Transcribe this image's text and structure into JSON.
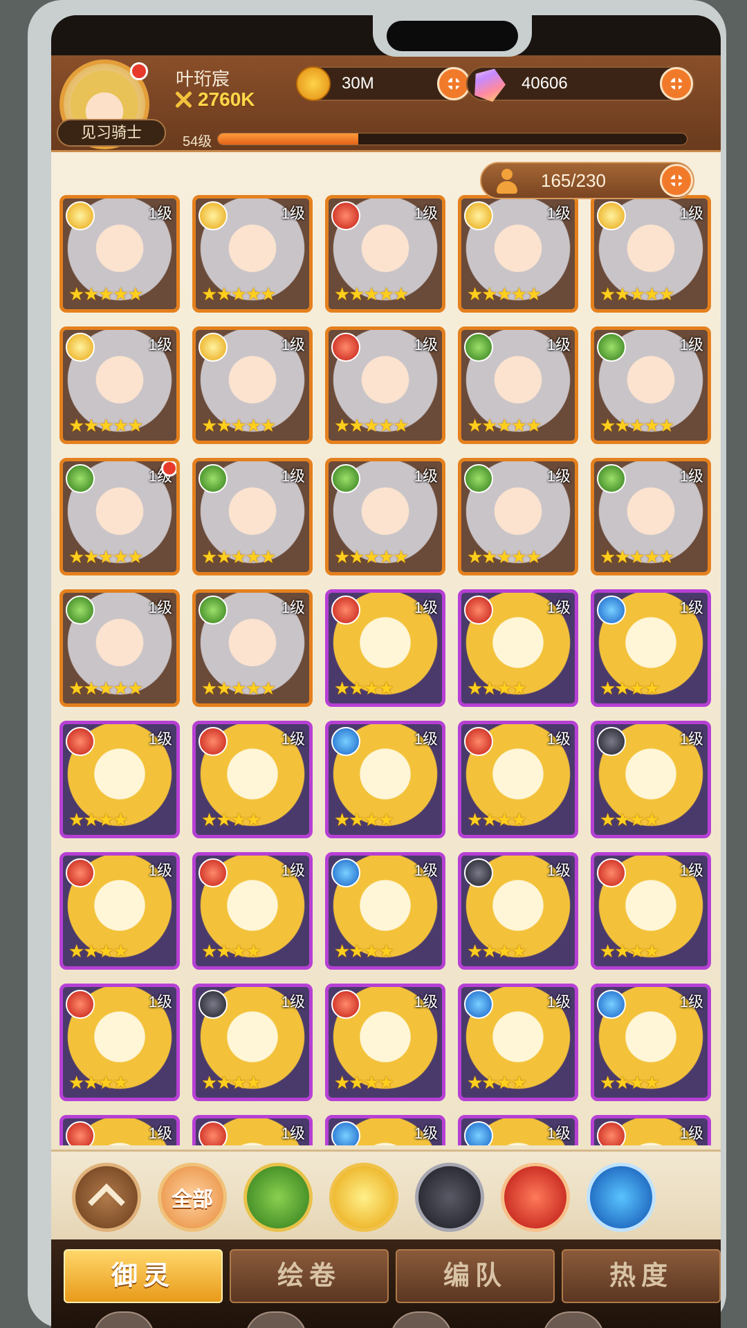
{
  "player": {
    "name": "叶珩宸",
    "power": "2760K",
    "level": "54级",
    "xp_fraction": 0.3,
    "title": "见习骑士"
  },
  "currency": {
    "gold": "30M",
    "gems": "40606"
  },
  "roster": {
    "count": "165/230"
  },
  "cards": [
    {
      "element": "gold",
      "level": "1级",
      "stars": "★★★★★",
      "frame": "orange",
      "notif": false
    },
    {
      "element": "gold",
      "level": "1级",
      "stars": "★★★★★",
      "frame": "orange",
      "notif": false
    },
    {
      "element": "red",
      "level": "1级",
      "stars": "★★★★★",
      "frame": "orange",
      "notif": false
    },
    {
      "element": "gold",
      "level": "1级",
      "stars": "★★★★★",
      "frame": "orange",
      "notif": false
    },
    {
      "element": "gold",
      "level": "1级",
      "stars": "★★★★★",
      "frame": "orange",
      "notif": false
    },
    {
      "element": "gold",
      "level": "1级",
      "stars": "★★★★★",
      "frame": "orange",
      "notif": false
    },
    {
      "element": "gold",
      "level": "1级",
      "stars": "★★★★★",
      "frame": "orange",
      "notif": false
    },
    {
      "element": "red",
      "level": "1级",
      "stars": "★★★★★",
      "frame": "orange",
      "notif": false
    },
    {
      "element": "green",
      "level": "1级",
      "stars": "★★★★★",
      "frame": "orange",
      "notif": false
    },
    {
      "element": "green",
      "level": "1级",
      "stars": "★★★★★",
      "frame": "orange",
      "notif": false
    },
    {
      "element": "green",
      "level": "1级",
      "stars": "★★★★★",
      "frame": "orange",
      "notif": true
    },
    {
      "element": "green",
      "level": "1级",
      "stars": "★★★★★",
      "frame": "orange",
      "notif": false
    },
    {
      "element": "green",
      "level": "1级",
      "stars": "★★★★★",
      "frame": "orange",
      "notif": false
    },
    {
      "element": "green",
      "level": "1级",
      "stars": "★★★★★",
      "frame": "orange",
      "notif": false
    },
    {
      "element": "green",
      "level": "1级",
      "stars": "★★★★★",
      "frame": "orange",
      "notif": false
    },
    {
      "element": "green",
      "level": "1级",
      "stars": "★★★★★",
      "frame": "orange",
      "notif": false
    },
    {
      "element": "green",
      "level": "1级",
      "stars": "★★★★★",
      "frame": "orange",
      "notif": false
    },
    {
      "element": "red",
      "level": "1级",
      "stars": "★★★★",
      "frame": "purple",
      "notif": false
    },
    {
      "element": "red",
      "level": "1级",
      "stars": "★★★★",
      "frame": "purple",
      "notif": false
    },
    {
      "element": "blue",
      "level": "1级",
      "stars": "★★★★",
      "frame": "purple",
      "notif": false
    },
    {
      "element": "red",
      "level": "1级",
      "stars": "★★★★",
      "frame": "purple",
      "notif": false
    },
    {
      "element": "red",
      "level": "1级",
      "stars": "★★★★",
      "frame": "purple",
      "notif": false
    },
    {
      "element": "blue",
      "level": "1级",
      "stars": "★★★★",
      "frame": "purple",
      "notif": false
    },
    {
      "element": "red",
      "level": "1级",
      "stars": "★★★★",
      "frame": "purple",
      "notif": false
    },
    {
      "element": "dark",
      "level": "1级",
      "stars": "★★★★",
      "frame": "purple",
      "notif": false
    },
    {
      "element": "red",
      "level": "1级",
      "stars": "★★★★",
      "frame": "purple",
      "notif": false
    },
    {
      "element": "red",
      "level": "1级",
      "stars": "★★★★",
      "frame": "purple",
      "notif": false
    },
    {
      "element": "blue",
      "level": "1级",
      "stars": "★★★★",
      "frame": "purple",
      "notif": false
    },
    {
      "element": "dark",
      "level": "1级",
      "stars": "★★★★",
      "frame": "purple",
      "notif": false
    },
    {
      "element": "red",
      "level": "1级",
      "stars": "★★★★",
      "frame": "purple",
      "notif": false
    },
    {
      "element": "red",
      "level": "1级",
      "stars": "★★★★",
      "frame": "purple",
      "notif": false
    },
    {
      "element": "dark",
      "level": "1级",
      "stars": "★★★★",
      "frame": "purple",
      "notif": false
    },
    {
      "element": "red",
      "level": "1级",
      "stars": "★★★★",
      "frame": "purple",
      "notif": false
    },
    {
      "element": "blue",
      "level": "1级",
      "stars": "★★★★",
      "frame": "purple",
      "notif": false
    },
    {
      "element": "blue",
      "level": "1级",
      "stars": "★★★★",
      "frame": "purple",
      "notif": false
    },
    {
      "element": "red",
      "level": "1级",
      "stars": "",
      "frame": "purple",
      "notif": false
    },
    {
      "element": "red",
      "level": "1级",
      "stars": "",
      "frame": "purple",
      "notif": false
    },
    {
      "element": "blue",
      "level": "1级",
      "stars": "",
      "frame": "purple",
      "notif": false
    },
    {
      "element": "blue",
      "level": "1级",
      "stars": "",
      "frame": "purple",
      "notif": false
    },
    {
      "element": "red",
      "level": "1级",
      "stars": "",
      "frame": "purple",
      "notif": false
    }
  ],
  "filters": [
    {
      "key": "collapse",
      "label": ""
    },
    {
      "key": "all",
      "label": "全部"
    },
    {
      "key": "green",
      "label": ""
    },
    {
      "key": "gold",
      "label": ""
    },
    {
      "key": "dark",
      "label": ""
    },
    {
      "key": "red",
      "label": ""
    },
    {
      "key": "blue",
      "label": ""
    }
  ],
  "tabs": [
    {
      "label": "御灵",
      "active": true
    },
    {
      "label": "绘卷",
      "active": false
    },
    {
      "label": "编队",
      "active": false
    },
    {
      "label": "热度",
      "active": false
    }
  ]
}
